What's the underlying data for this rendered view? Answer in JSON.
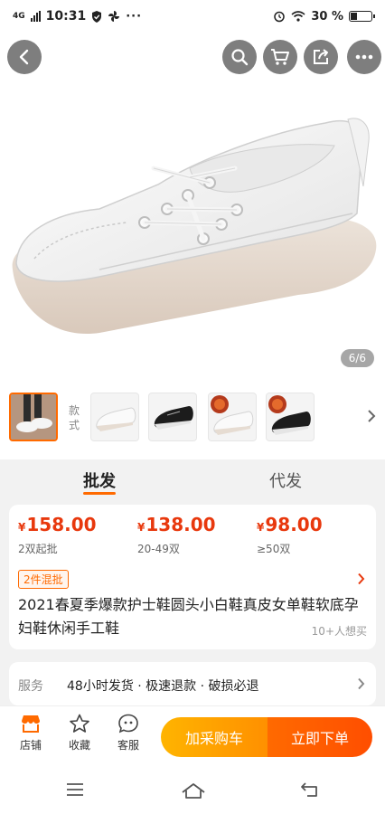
{
  "status": {
    "network": "4G",
    "time": "10:31",
    "battery": "30 %"
  },
  "gallery": {
    "counter": "6/6"
  },
  "variants": {
    "label": "款式"
  },
  "tabs": [
    {
      "label": "批发"
    },
    {
      "label": "代发"
    }
  ],
  "pricing": {
    "currency": "¥",
    "tiers": [
      {
        "price": "158.00",
        "qty": "2双起批"
      },
      {
        "price": "138.00",
        "qty": "20-49双"
      },
      {
        "price": "98.00",
        "qty": "≥50双"
      }
    ],
    "mix_badge": "2件混批"
  },
  "product": {
    "title": "2021春夏季爆款护士鞋圆头小白鞋真皮女单鞋软底孕妇鞋休闲手工鞋",
    "buyers": "10+人想买"
  },
  "service": {
    "label": "服务",
    "text": "48小时发货 · 极速退款 · 破损必退"
  },
  "bottom_bar": {
    "shop": "店铺",
    "favorite": "收藏",
    "support": "客服",
    "add_to_cart": "加采购车",
    "order_now": "立即下单"
  },
  "colors": {
    "accent": "#ff6a00",
    "price": "#e8380d",
    "cart_button": "#ffa800"
  }
}
